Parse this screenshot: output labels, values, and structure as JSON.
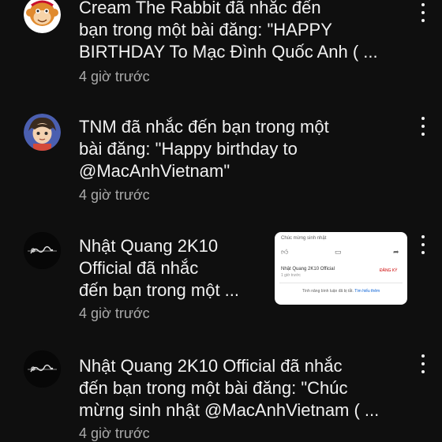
{
  "notifications": [
    {
      "lines": [
        "Cream The Rabbit đã nhắc đến",
        "bạn trong một bài đăng: \"HAPPY",
        "BIRTHDAY To Mạc Đình Quốc Anh ( ..."
      ],
      "time": "4 giờ trước",
      "avatar_icon": "monkey-avatar-icon"
    },
    {
      "lines": [
        "TNM đã nhắc đến bạn trong một",
        "bài đăng: \"Happy birthday to",
        "@MacAnhVietnam\""
      ],
      "time": "4 giờ trước",
      "avatar_icon": "anime-character-avatar-icon"
    },
    {
      "lines": [
        "Nhật Quang 2K10",
        "Official đã nhắc",
        "đến bạn trong một ..."
      ],
      "time": "4 giờ trước",
      "avatar_icon": "nhat-quang-logo-avatar-icon"
    },
    {
      "lines": [
        "Nhật Quang 2K10 Official đã nhắc",
        "đến bạn trong một bài đăng: \"Chúc",
        "mừng sinh nhật @MacAnhVietnam ( ..."
      ],
      "time": "4 giờ trước",
      "avatar_icon": "nhat-quang-logo-avatar-icon"
    }
  ],
  "thumbnail": {
    "top_text": "Chúc mừng sinh nhật",
    "channel_name": "Nhật Quang 2K10 Official",
    "subtext": "1 giờ trước",
    "red_label": "ĐĂNG KÝ",
    "bottom_text": "Tính năng bình luận đã bị tắt.",
    "bottom_link": "Tìm hiểu thêm"
  }
}
